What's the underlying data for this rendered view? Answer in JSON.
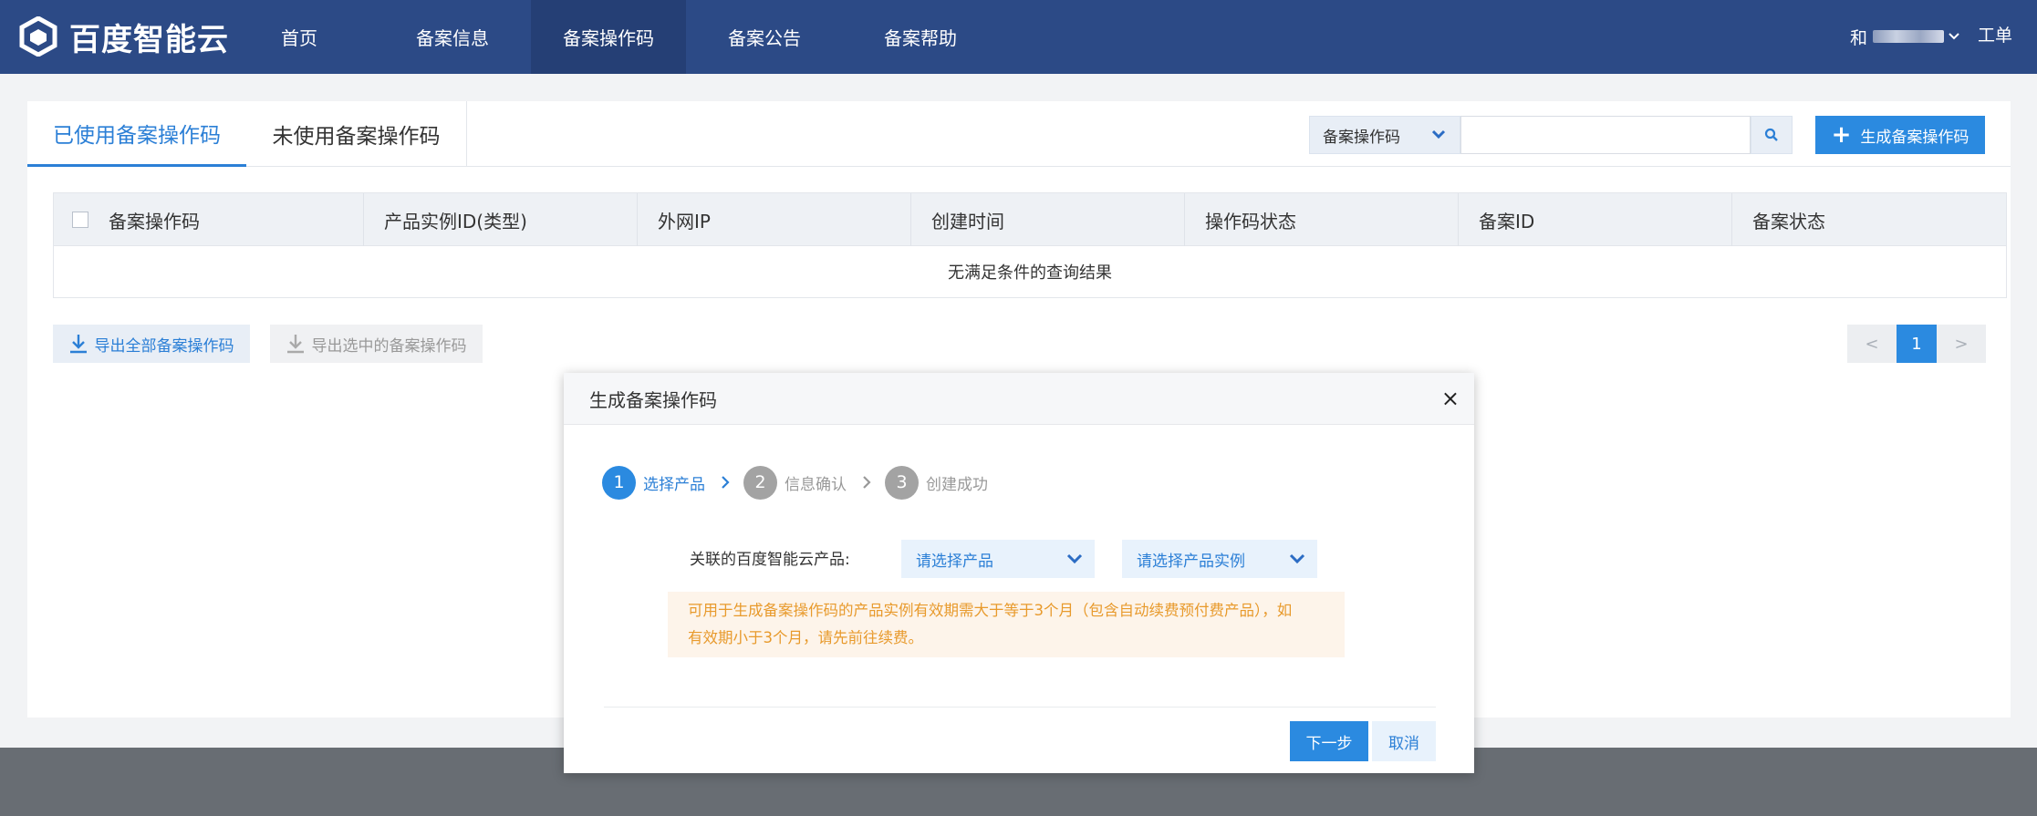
{
  "brand": {
    "name": "百度智能云"
  },
  "nav": {
    "items": [
      {
        "label": "首页"
      },
      {
        "label": "备案信息"
      },
      {
        "label": "备案操作码"
      },
      {
        "label": "备案公告"
      },
      {
        "label": "备案帮助"
      }
    ],
    "active_index": 2,
    "user_initial": "和",
    "ticket_label": "工单"
  },
  "tabs": {
    "used_label": "已使用备案操作码",
    "unused_label": "未使用备案操作码",
    "active": "used"
  },
  "search": {
    "type_label": "备案操作码",
    "value": "",
    "placeholder": ""
  },
  "toolbar": {
    "create_label": "生成备案操作码",
    "export_all_label": "导出全部备案操作码",
    "export_selected_label": "导出选中的备案操作码"
  },
  "table": {
    "columns": [
      "备案操作码",
      "产品实例ID(类型)",
      "外网IP",
      "创建时间",
      "操作码状态",
      "备案ID",
      "备案状态"
    ],
    "empty_text": "无满足条件的查询结果"
  },
  "pagination": {
    "prev": "<",
    "current": "1",
    "next": ">"
  },
  "modal": {
    "title": "生成备案操作码",
    "close_glyph": "×",
    "steps": [
      {
        "num": "1",
        "label": "选择产品",
        "active": true
      },
      {
        "num": "2",
        "label": "信息确认",
        "active": false
      },
      {
        "num": "3",
        "label": "创建成功",
        "active": false
      }
    ],
    "product_label": "关联的百度智能云产品:",
    "product_select": "请选择产品",
    "instance_select": "请选择产品实例",
    "warning_line1": "可用于生成备案操作码的产品实例有效期需大于等于3个月（包含自动续费预付费产品），如",
    "warning_line2": "有效期小于3个月，请先前往续费。",
    "next_label": "下一步",
    "cancel_label": "取消"
  },
  "colors": {
    "nav_bg": "#2c4a86",
    "accent": "#2b8ae0",
    "warning_text": "#e89a2c",
    "warning_bg": "#fdf4ea"
  }
}
